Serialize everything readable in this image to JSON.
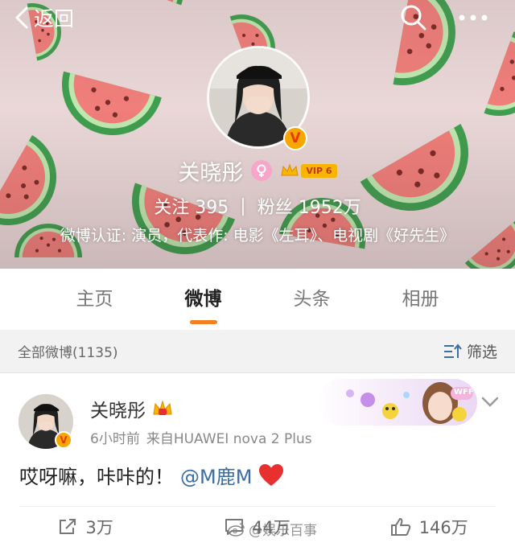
{
  "nav": {
    "back_label": "返回"
  },
  "profile": {
    "name": "关晓彤",
    "vip_label": "VIP 6",
    "following_label": "关注",
    "following_count": "395",
    "separator": "|",
    "followers_label": "粉丝",
    "followers_count": "1952万",
    "verification": "微博认证: 演员，代表作: 电影《左耳》、电视剧《好先生》"
  },
  "tabs": [
    {
      "label": "主页",
      "active": false
    },
    {
      "label": "微博",
      "active": true
    },
    {
      "label": "头条",
      "active": false
    },
    {
      "label": "相册",
      "active": false
    }
  ],
  "filter": {
    "all_label": "全部微博(1135)",
    "filter_label": "筛选"
  },
  "post": {
    "author": "关晓彤",
    "time": "6小时前",
    "source": "来自HUAWEI nova 2 Plus",
    "text": "哎呀嘛，咔咔的！",
    "mention": "@M鹿M",
    "card_badge": "WFF"
  },
  "actions": {
    "repost": "3万",
    "comment": "44万",
    "like": "146万"
  },
  "watermark": "@娱乐百事",
  "colors": {
    "accent": "#f08020",
    "link": "#3c6ea3",
    "verified": "#f7a800",
    "heart": "#e8312f"
  },
  "icons": [
    "back-icon",
    "search-icon",
    "more-icon",
    "verified-v-icon",
    "female-icon",
    "vip-crown-icon",
    "filter-icon",
    "chevron-down-icon",
    "heart-icon",
    "repost-icon",
    "comment-icon",
    "like-icon",
    "weibo-logo-icon"
  ]
}
